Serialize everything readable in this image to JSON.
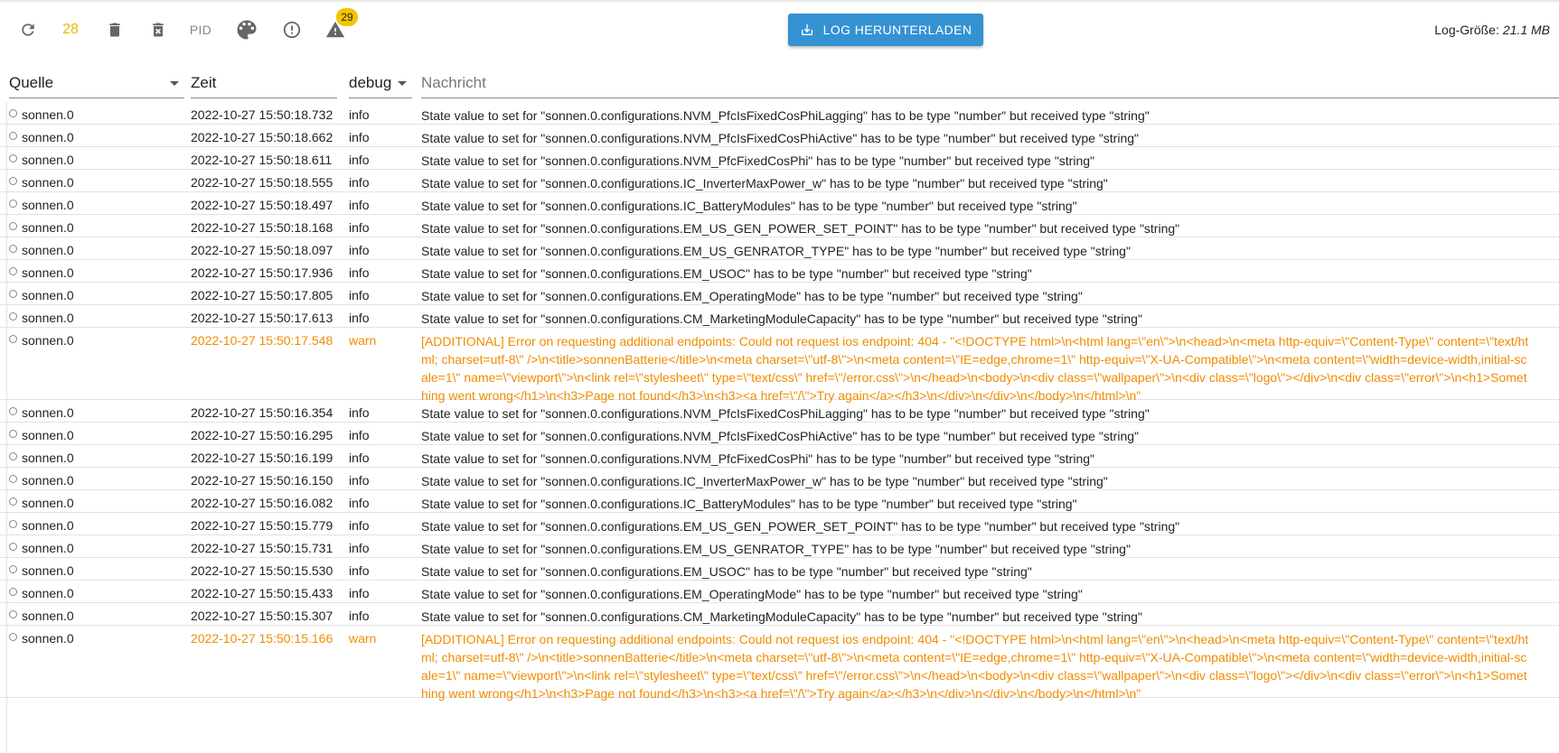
{
  "toolbar": {
    "refresh_icon": "refresh-icon",
    "count": "28",
    "pid_label": "PID",
    "warn_badge": "29",
    "download_label": "LOG HERUNTERLADEN",
    "log_size_label": "Log-Größe:",
    "log_size_value": "21.1 MB"
  },
  "columns": {
    "source": "Quelle",
    "time": "Zeit",
    "level": "debug",
    "message": "Nachricht"
  },
  "colors": {
    "accent": "#3592d2",
    "warn": "#f08c00",
    "badge": "#f5c400"
  },
  "rows": [
    {
      "src": "sonnen.0",
      "time": "2022-10-27 15:50:18.732",
      "sev": "info",
      "msg": "State value to set for \"sonnen.0.configurations.NVM_PfcIsFixedCosPhiLagging\" has to be type \"number\" but received type \"string\""
    },
    {
      "src": "sonnen.0",
      "time": "2022-10-27 15:50:18.662",
      "sev": "info",
      "msg": "State value to set for \"sonnen.0.configurations.NVM_PfcIsFixedCosPhiActive\" has to be type \"number\" but received type \"string\""
    },
    {
      "src": "sonnen.0",
      "time": "2022-10-27 15:50:18.611",
      "sev": "info",
      "msg": "State value to set for \"sonnen.0.configurations.NVM_PfcFixedCosPhi\" has to be type \"number\" but received type \"string\""
    },
    {
      "src": "sonnen.0",
      "time": "2022-10-27 15:50:18.555",
      "sev": "info",
      "msg": "State value to set for \"sonnen.0.configurations.IC_InverterMaxPower_w\" has to be type \"number\" but received type \"string\""
    },
    {
      "src": "sonnen.0",
      "time": "2022-10-27 15:50:18.497",
      "sev": "info",
      "msg": "State value to set for \"sonnen.0.configurations.IC_BatteryModules\" has to be type \"number\" but received type \"string\""
    },
    {
      "src": "sonnen.0",
      "time": "2022-10-27 15:50:18.168",
      "sev": "info",
      "msg": "State value to set for \"sonnen.0.configurations.EM_US_GEN_POWER_SET_POINT\" has to be type \"number\" but received type \"string\""
    },
    {
      "src": "sonnen.0",
      "time": "2022-10-27 15:50:18.097",
      "sev": "info",
      "msg": "State value to set for \"sonnen.0.configurations.EM_US_GENRATOR_TYPE\" has to be type \"number\" but received type \"string\""
    },
    {
      "src": "sonnen.0",
      "time": "2022-10-27 15:50:17.936",
      "sev": "info",
      "msg": "State value to set for \"sonnen.0.configurations.EM_USOC\" has to be type \"number\" but received type \"string\""
    },
    {
      "src": "sonnen.0",
      "time": "2022-10-27 15:50:17.805",
      "sev": "info",
      "msg": "State value to set for \"sonnen.0.configurations.EM_OperatingMode\" has to be type \"number\" but received type \"string\""
    },
    {
      "src": "sonnen.0",
      "time": "2022-10-27 15:50:17.613",
      "sev": "info",
      "msg": "State value to set for \"sonnen.0.configurations.CM_MarketingModuleCapacity\" has to be type \"number\" but received type \"string\""
    },
    {
      "src": "sonnen.0",
      "time": "2022-10-27 15:50:17.548",
      "sev": "warn",
      "msg": "[ADDITIONAL] Error on requesting additional endpoints: Could not request ios endpoint: 404 - \"<!DOCTYPE html>\\n<html lang=\\\"en\\\">\\n<head>\\n<meta http-equiv=\\\"Content-Type\\\" content=\\\"text/html; charset=utf-8\\\" />\\n<title>sonnenBatterie</title>\\n<meta charset=\\\"utf-8\\\">\\n<meta content=\\\"IE=edge,chrome=1\\\" http-equiv=\\\"X-UA-Compatible\\\">\\n<meta content=\\\"width=device-width,initial-scale=1\\\" name=\\\"viewport\\\">\\n<link rel=\\\"stylesheet\\\" type=\\\"text/css\\\" href=\\\"/error.css\\\">\\n</head>\\n<body>\\n<div class=\\\"wallpaper\\\">\\n<div class=\\\"logo\\\"></div>\\n<div class=\\\"error\\\">\\n<h1>Something went wrong</h1>\\n<h3>Page not found</h3>\\n<h3><a href=\\\"/\\\">Try again</a></h3>\\n</div>\\n</div>\\n</body>\\n</html>\\n\""
    },
    {
      "src": "sonnen.0",
      "time": "2022-10-27 15:50:16.354",
      "sev": "info",
      "msg": "State value to set for \"sonnen.0.configurations.NVM_PfcIsFixedCosPhiLagging\" has to be type \"number\" but received type \"string\""
    },
    {
      "src": "sonnen.0",
      "time": "2022-10-27 15:50:16.295",
      "sev": "info",
      "msg": "State value to set for \"sonnen.0.configurations.NVM_PfcIsFixedCosPhiActive\" has to be type \"number\" but received type \"string\""
    },
    {
      "src": "sonnen.0",
      "time": "2022-10-27 15:50:16.199",
      "sev": "info",
      "msg": "State value to set for \"sonnen.0.configurations.NVM_PfcFixedCosPhi\" has to be type \"number\" but received type \"string\""
    },
    {
      "src": "sonnen.0",
      "time": "2022-10-27 15:50:16.150",
      "sev": "info",
      "msg": "State value to set for \"sonnen.0.configurations.IC_InverterMaxPower_w\" has to be type \"number\" but received type \"string\""
    },
    {
      "src": "sonnen.0",
      "time": "2022-10-27 15:50:16.082",
      "sev": "info",
      "msg": "State value to set for \"sonnen.0.configurations.IC_BatteryModules\" has to be type \"number\" but received type \"string\""
    },
    {
      "src": "sonnen.0",
      "time": "2022-10-27 15:50:15.779",
      "sev": "info",
      "msg": "State value to set for \"sonnen.0.configurations.EM_US_GEN_POWER_SET_POINT\" has to be type \"number\" but received type \"string\""
    },
    {
      "src": "sonnen.0",
      "time": "2022-10-27 15:50:15.731",
      "sev": "info",
      "msg": "State value to set for \"sonnen.0.configurations.EM_US_GENRATOR_TYPE\" has to be type \"number\" but received type \"string\""
    },
    {
      "src": "sonnen.0",
      "time": "2022-10-27 15:50:15.530",
      "sev": "info",
      "msg": "State value to set for \"sonnen.0.configurations.EM_USOC\" has to be type \"number\" but received type \"string\""
    },
    {
      "src": "sonnen.0",
      "time": "2022-10-27 15:50:15.433",
      "sev": "info",
      "msg": "State value to set for \"sonnen.0.configurations.EM_OperatingMode\" has to be type \"number\" but received type \"string\""
    },
    {
      "src": "sonnen.0",
      "time": "2022-10-27 15:50:15.307",
      "sev": "info",
      "msg": "State value to set for \"sonnen.0.configurations.CM_MarketingModuleCapacity\" has to be type \"number\" but received type \"string\""
    },
    {
      "src": "sonnen.0",
      "time": "2022-10-27 15:50:15.166",
      "sev": "warn",
      "msg": "[ADDITIONAL] Error on requesting additional endpoints: Could not request ios endpoint: 404 - \"<!DOCTYPE html>\\n<html lang=\\\"en\\\">\\n<head>\\n<meta http-equiv=\\\"Content-Type\\\" content=\\\"text/html; charset=utf-8\\\" />\\n<title>sonnenBatterie</title>\\n<meta charset=\\\"utf-8\\\">\\n<meta content=\\\"IE=edge,chrome=1\\\" http-equiv=\\\"X-UA-Compatible\\\">\\n<meta content=\\\"width=device-width,initial-scale=1\\\" name=\\\"viewport\\\">\\n<link rel=\\\"stylesheet\\\" type=\\\"text/css\\\" href=\\\"/error.css\\\">\\n</head>\\n<body>\\n<div class=\\\"wallpaper\\\">\\n<div class=\\\"logo\\\"></div>\\n<div class=\\\"error\\\">\\n<h1>Something went wrong</h1>\\n<h3>Page not found</h3>\\n<h3><a href=\\\"/\\\">Try again</a></h3>\\n</div>\\n</div>\\n</body>\\n</html>\\n\""
    }
  ]
}
